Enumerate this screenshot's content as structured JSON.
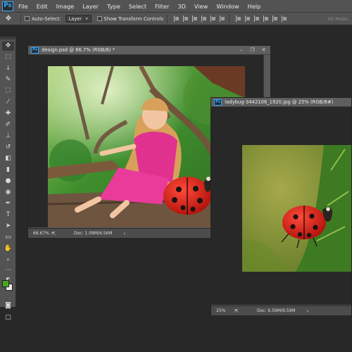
{
  "app": {
    "logo": "Ps"
  },
  "menu": [
    "File",
    "Edit",
    "Image",
    "Layer",
    "Type",
    "Select",
    "Filter",
    "3D",
    "View",
    "Window",
    "Help"
  ],
  "options": {
    "auto_select_label": "Auto-Select:",
    "auto_select_value": "Layer",
    "show_transform_label": "Show Transform Controls",
    "mode_3d": "3D Mode:"
  },
  "doc1": {
    "title": "design.psd @ 66.7% (RGB/8) *",
    "zoom": "66.67%",
    "doc_size": "Doc: 1.09M/6.56M"
  },
  "doc2": {
    "title": "ladybug-3442106_1920.jpg @ 25% (RGB/8#)",
    "zoom": "25%",
    "doc_size": "Doc: 6.59M/6.59M"
  },
  "colors": {
    "foreground": "#44a81c",
    "background": "#eaeaea",
    "accent": "#31a8ff"
  },
  "icons": {
    "move": "move-icon",
    "export": "export-icon",
    "arrow": "chevron-right-icon"
  }
}
